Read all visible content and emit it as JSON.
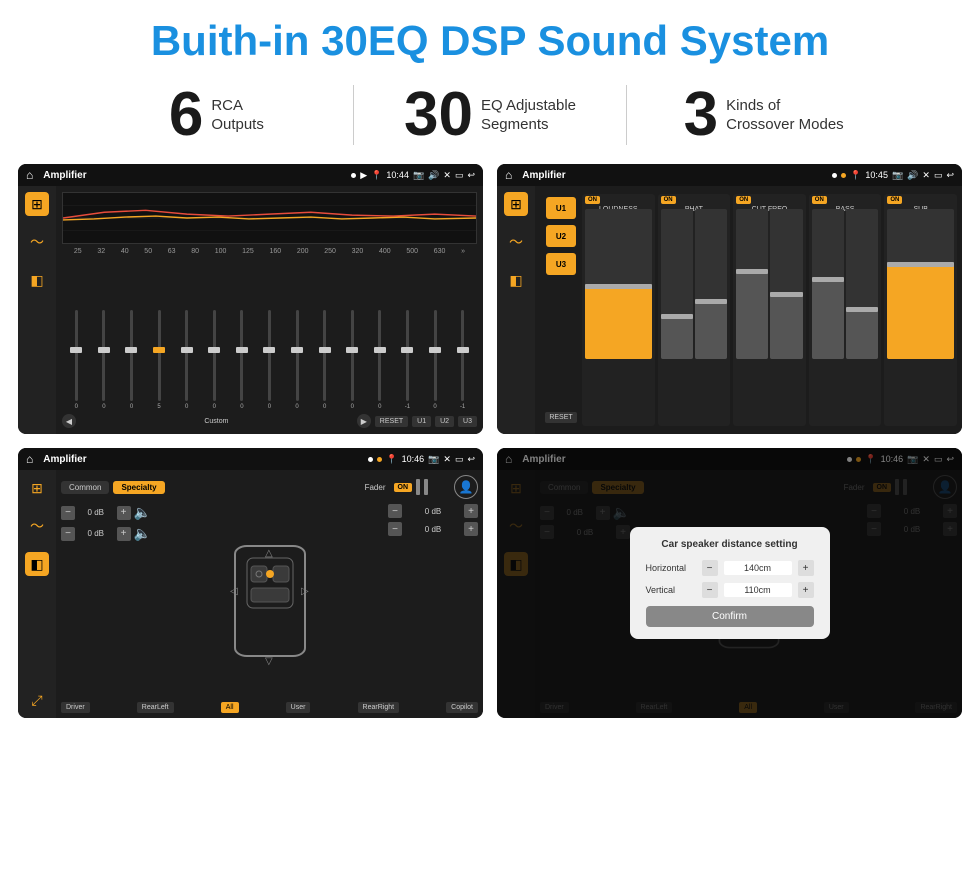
{
  "header": {
    "title": "Buith-in 30EQ DSP Sound System"
  },
  "stats": [
    {
      "number": "6",
      "label": "RCA\nOutputs"
    },
    {
      "number": "30",
      "label": "EQ Adjustable\nSegments"
    },
    {
      "number": "3",
      "label": "Kinds of\nCrossover Modes"
    }
  ],
  "screens": {
    "eq_screen": {
      "app_title": "Amplifier",
      "time": "10:44",
      "freq_bands": [
        "25",
        "32",
        "40",
        "50",
        "63",
        "80",
        "100",
        "125",
        "160",
        "200",
        "250",
        "320",
        "400",
        "500",
        "630"
      ],
      "values": [
        "0",
        "0",
        "0",
        "5",
        "0",
        "0",
        "0",
        "0",
        "0",
        "0",
        "0",
        "0",
        "-1",
        "0",
        "-1"
      ],
      "bottom_buttons": [
        "RESET",
        "U1",
        "U2",
        "U3"
      ],
      "preset": "Custom"
    },
    "crossover_screen": {
      "app_title": "Amplifier",
      "time": "10:45",
      "channels": [
        "LOUDNESS",
        "PHAT",
        "CUT FREQ",
        "BASS",
        "SUB"
      ],
      "u_buttons": [
        "U1",
        "U2",
        "U3"
      ],
      "reset_label": "RESET"
    },
    "speaker_screen": {
      "app_title": "Amplifier",
      "time": "10:46",
      "tabs": [
        "Common",
        "Specialty"
      ],
      "fader_label": "Fader",
      "on_label": "ON",
      "positions": {
        "driver": "Driver",
        "rear_left": "RearLeft",
        "all": "All",
        "user": "User",
        "rear_right": "RearRight",
        "copilot": "Copilot"
      },
      "volumes": [
        "0 dB",
        "0 dB",
        "0 dB",
        "0 dB"
      ]
    },
    "dialog_screen": {
      "app_title": "Amplifier",
      "time": "10:46",
      "dialog_title": "Car speaker distance setting",
      "horizontal_label": "Horizontal",
      "horizontal_value": "140cm",
      "vertical_label": "Vertical",
      "vertical_value": "110cm",
      "confirm_label": "Confirm",
      "tabs": [
        "Common",
        "Specialty"
      ],
      "on_label": "ON",
      "driver": "Driver",
      "rear_left": "RearLeft",
      "all_label": "All",
      "user": "User",
      "rear_right": "RearRight"
    }
  }
}
